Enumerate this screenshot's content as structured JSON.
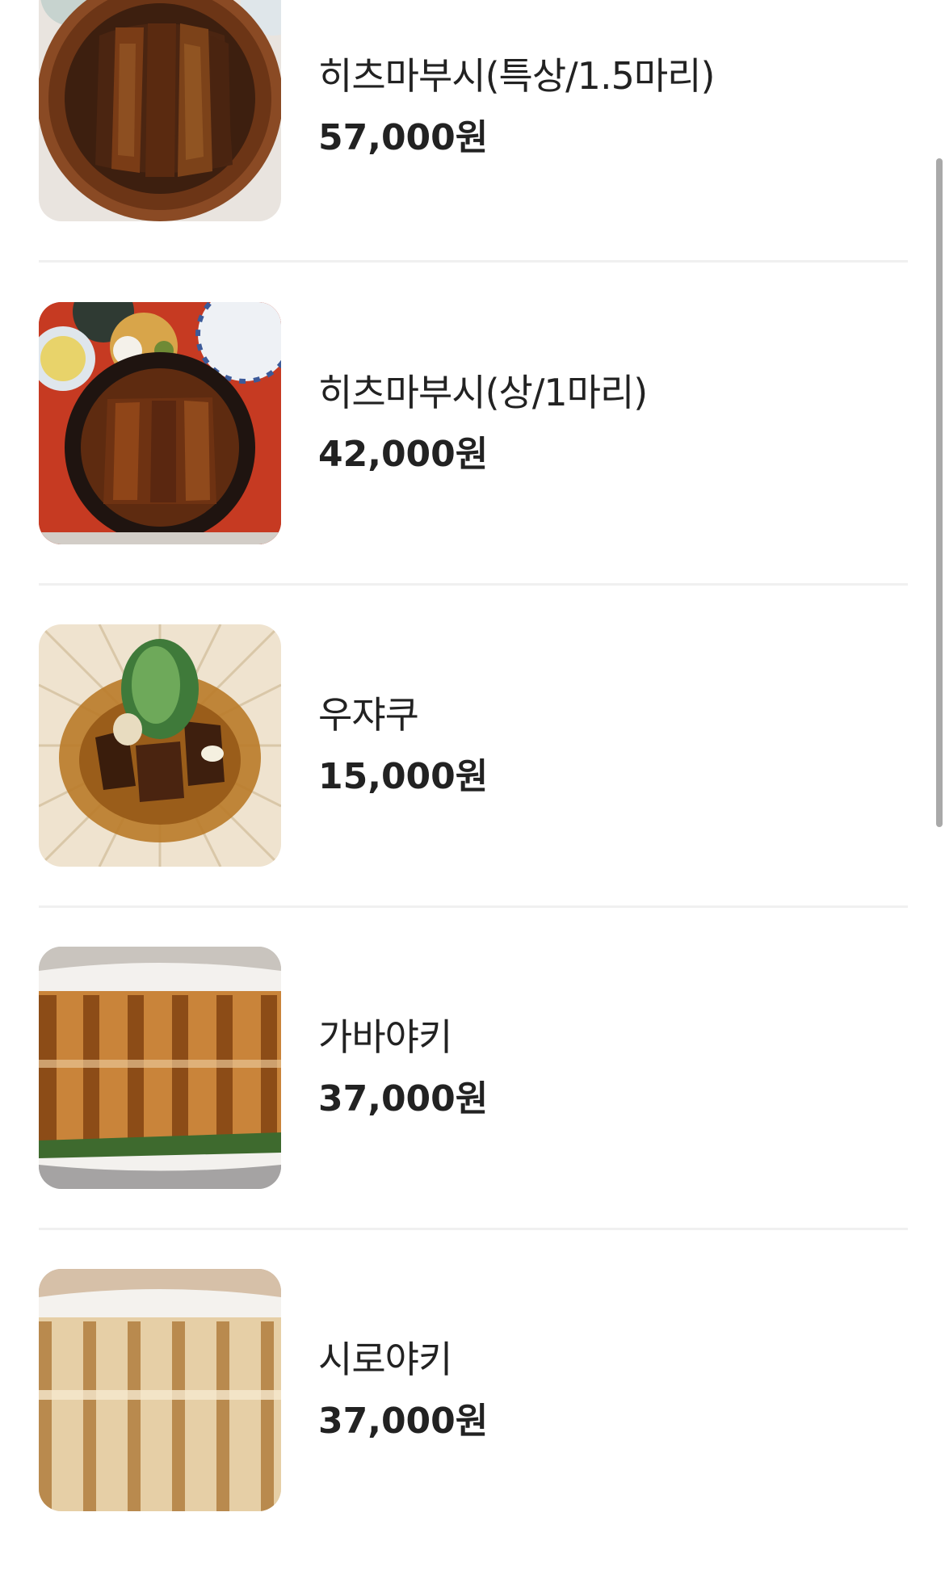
{
  "menu": {
    "items": [
      {
        "name": "히츠마부시(특상/1.5마리)",
        "price": "57,000원",
        "image": "hitsumabushi-premium-photo"
      },
      {
        "name": "히츠마부시(상/1마리)",
        "price": "42,000원",
        "image": "hitsumabushi-set-photo"
      },
      {
        "name": "우쟈쿠",
        "price": "15,000원",
        "image": "uzaku-photo"
      },
      {
        "name": "가바야키",
        "price": "37,000원",
        "image": "kabayaki-photo"
      },
      {
        "name": "시로야키",
        "price": "37,000원",
        "image": "shirayaki-photo"
      }
    ]
  },
  "colors": {
    "text": "#222222",
    "divider": "#f0f0f0",
    "scrollbar": "#a9a9a9"
  }
}
